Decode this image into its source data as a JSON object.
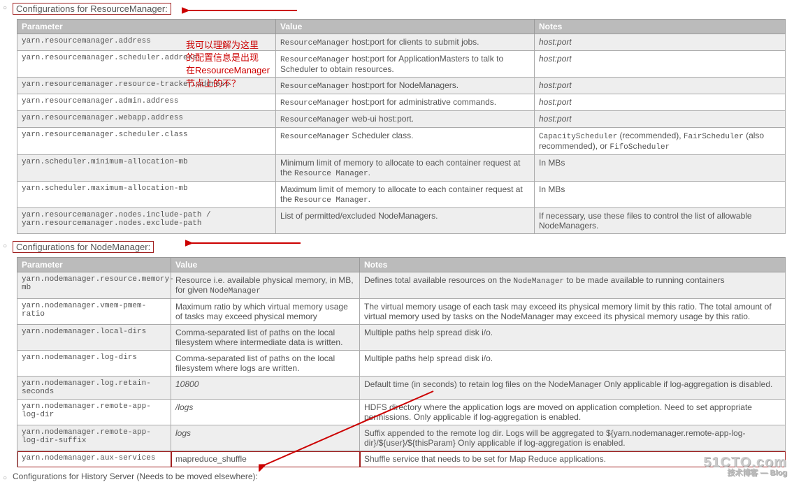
{
  "section1": {
    "title": "Configurations for ResourceManager:",
    "headers": {
      "param": "Parameter",
      "value": "Value",
      "notes": "Notes"
    },
    "rows": [
      {
        "param": "yarn.resourcemanager.address",
        "value_pre": "ResourceManager",
        "value_post": " host:port for clients to submit jobs.",
        "notes": "host:port",
        "notes_italic": true
      },
      {
        "param": "yarn.resourcemanager.scheduler.address",
        "value_pre": "ResourceManager",
        "value_post": " host:port for ApplicationMasters to talk to Scheduler to obtain resources.",
        "notes": "host:port",
        "notes_italic": true
      },
      {
        "param": "yarn.resourcemanager.resource-tracker.address",
        "value_pre": "ResourceManager",
        "value_post": " host:port for NodeManagers.",
        "notes": "host:port",
        "notes_italic": true
      },
      {
        "param": "yarn.resourcemanager.admin.address",
        "value_pre": "ResourceManager",
        "value_post": " host:port for administrative commands.",
        "notes": "host:port",
        "notes_italic": true
      },
      {
        "param": "yarn.resourcemanager.webapp.address",
        "value_pre": "ResourceManager",
        "value_post": " web-ui host:port.",
        "notes": "host:port",
        "notes_italic": true
      },
      {
        "param": "yarn.resourcemanager.scheduler.class",
        "value_pre": "ResourceManager",
        "value_post": " Scheduler class.",
        "notes_html": "<code class='mono'>CapacityScheduler</code> (recommended), <code class='mono'>FairScheduler</code> (also recommended), or <code class='mono'>FifoScheduler</code>"
      },
      {
        "param": "yarn.scheduler.minimum-allocation-mb",
        "value_plain": "Minimum limit of memory to allocate to each container request at the ",
        "value_tail_mono": "Resource Manager",
        "value_tail_post": ".",
        "notes": "In MBs"
      },
      {
        "param": "yarn.scheduler.maximum-allocation-mb",
        "value_plain": "Maximum limit of memory to allocate to each container request at the ",
        "value_tail_mono": "Resource Manager",
        "value_tail_post": ".",
        "notes": "In MBs"
      },
      {
        "param": "yarn.resourcemanager.nodes.include-path / yarn.resourcemanager.nodes.exclude-path",
        "value_plain": "List of permitted/excluded NodeManagers.",
        "notes": "If necessary, use these files to control the list of allowable NodeManagers."
      }
    ]
  },
  "section2": {
    "title": "Configurations for NodeManager:",
    "headers": {
      "param": "Parameter",
      "value": "Value",
      "notes": "Notes"
    },
    "rows": [
      {
        "param": "yarn.nodemanager.resource.memory-mb",
        "value_html": "Resource i.e. available physical memory, in MB, for given <code class='mono'>NodeManager</code>",
        "notes_html": "Defines total available resources on the <code class='mono'>NodeManager</code> to be made available to running containers"
      },
      {
        "param": "yarn.nodemanager.vmem-pmem-ratio",
        "value": "Maximum ratio by which virtual memory usage of tasks may exceed physical memory",
        "notes": "The virtual memory usage of each task may exceed its physical memory limit by this ratio. The total amount of virtual memory used by tasks on the NodeManager may exceed its physical memory usage by this ratio."
      },
      {
        "param": "yarn.nodemanager.local-dirs",
        "value": "Comma-separated list of paths on the local filesystem where intermediate data is written.",
        "notes": "Multiple paths help spread disk i/o."
      },
      {
        "param": "yarn.nodemanager.log-dirs",
        "value": "Comma-separated list of paths on the local filesystem where logs are written.",
        "notes": "Multiple paths help spread disk i/o."
      },
      {
        "param": "yarn.nodemanager.log.retain-seconds",
        "value": "10800",
        "value_italic": true,
        "notes": "Default time (in seconds) to retain log files on the NodeManager Only applicable if log-aggregation is disabled."
      },
      {
        "param": "yarn.nodemanager.remote-app-log-dir",
        "value": "/logs",
        "value_italic": true,
        "notes": "HDFS directory where the application logs are moved on application completion. Need to set appropriate permissions. Only applicable if log-aggregation is enabled."
      },
      {
        "param": "yarn.nodemanager.remote-app-log-dir-suffix",
        "value": "logs",
        "value_italic": true,
        "notes": "Suffix appended to the remote log dir. Logs will be aggregated to ${yarn.nodemanager.remote-app-log-dir}/${user}/${thisParam} Only applicable if log-aggregation is enabled."
      },
      {
        "param": "yarn.nodemanager.aux-services",
        "value": "mapreduce_shuffle",
        "notes": "Shuffle service that needs to be set for Map Reduce applications.",
        "highlight": true
      }
    ]
  },
  "section3": {
    "title": "Configurations for History Server (Needs to be moved elsewhere):"
  },
  "annotation": {
    "line1": "我可以理解为这里",
    "line2": "的配置信息是出现",
    "line3": "在ResourceManager",
    "line4": "节点上的不？"
  },
  "watermark": {
    "main": "51CTO.com",
    "sub": "技术博客 — Blog"
  }
}
